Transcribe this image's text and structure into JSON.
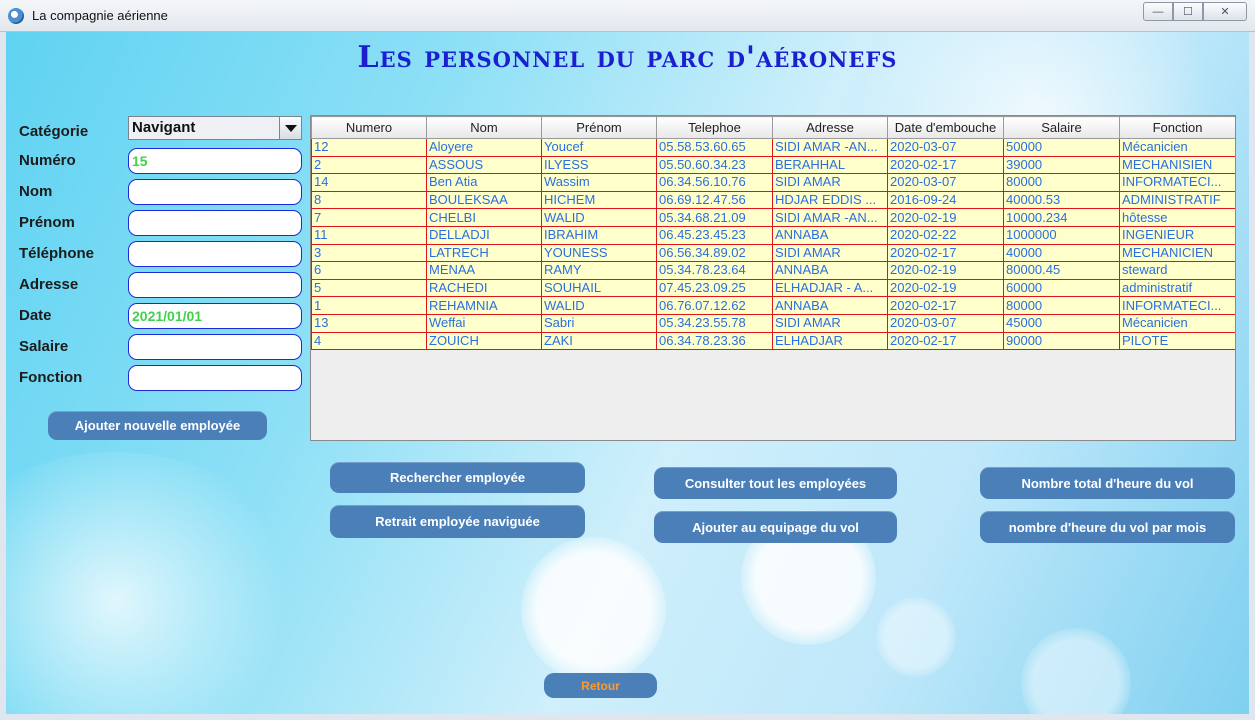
{
  "window": {
    "title": "La compagnie aérienne",
    "minimize_glyph": "—",
    "maximize_glyph": "☐",
    "close_glyph": "✕"
  },
  "page_title": "Les personnel du parc d'aéronefs",
  "form": {
    "labels": {
      "categorie": "Catégorie",
      "numero": "Numéro",
      "nom": "Nom",
      "prenom": "Prénom",
      "telephone": "Téléphone",
      "adresse": "Adresse",
      "date": "Date",
      "salaire": "Salaire",
      "fonction": "Fonction"
    },
    "values": {
      "categorie": "Navigant",
      "numero": "15",
      "nom": "",
      "prenom": "",
      "telephone": "",
      "adresse": "",
      "date": "2021/01/01",
      "salaire": "",
      "fonction": ""
    }
  },
  "buttons": {
    "ajouter": "Ajouter nouvelle employée",
    "rechercher": "Rechercher employée",
    "retrait": "Retrait employée naviguée",
    "consulter": "Consulter tout les employées",
    "equipage": "Ajouter au equipage du vol",
    "total_heures": "Nombre total d'heure du vol",
    "heures_mois": "nombre d'heure du vol par mois",
    "retour": "Retour"
  },
  "table": {
    "columns": [
      "Numero",
      "Nom",
      "Prénom",
      "Telephoe",
      "Adresse",
      "Date d'embouche",
      "Salaire",
      "Fonction"
    ],
    "rows": [
      [
        "12",
        "Aloyere",
        "Youcef",
        "05.58.53.60.65",
        "SIDI AMAR -AN...",
        "2020-03-07",
        "50000",
        "Mécanicien"
      ],
      [
        "2",
        "ASSOUS",
        "ILYESS",
        "05.50.60.34.23",
        "BERAHHAL",
        "2020-02-17",
        "39000",
        "MECHANISIEN"
      ],
      [
        "14",
        "Ben Atia",
        "Wassim",
        "06.34.56.10.76",
        "SIDI AMAR",
        "2020-03-07",
        "80000",
        "INFORMATECI..."
      ],
      [
        "8",
        "BOULEKSAA",
        "HICHEM",
        "06.69.12.47.56",
        "HDJAR EDDIS ...",
        "2016-09-24",
        "40000.53",
        "ADMINISTRATIF"
      ],
      [
        "7",
        "CHELBI",
        "WALID",
        "05.34.68.21.09",
        "SIDI AMAR -AN...",
        "2020-02-19",
        "10000.234",
        "hôtesse"
      ],
      [
        "11",
        "DELLADJI",
        "IBRAHIM",
        "06.45.23.45.23",
        "ANNABA",
        "2020-02-22",
        "1000000",
        "INGENIEUR"
      ],
      [
        "3",
        "LATRECH",
        "YOUNESS",
        "06.56.34.89.02",
        "SIDI AMAR",
        "2020-02-17",
        "40000",
        "MECHANICIEN"
      ],
      [
        "6",
        "MENAA",
        "RAMY",
        "05.34.78.23.64",
        "ANNABA",
        "2020-02-19",
        "80000.45",
        "steward"
      ],
      [
        "5",
        "RACHEDI",
        "SOUHAIL",
        "07.45.23.09.25",
        "ELHADJAR - A...",
        "2020-02-19",
        "60000",
        "administratif"
      ],
      [
        "1",
        "REHAMNIA",
        "WALID",
        "06.76.07.12.62",
        "ANNABA",
        "2020-02-17",
        "80000",
        "INFORMATECI..."
      ],
      [
        "13",
        "Weffai",
        "Sabri",
        "05.34.23.55.78",
        "SIDI AMAR",
        "2020-03-07",
        "45000",
        "Mécanicien"
      ],
      [
        "4",
        "ZOUICH",
        "ZAKI",
        "06.34.78.23.36",
        "ELHADJAR",
        "2020-02-17",
        "90000",
        "PILOTE"
      ]
    ]
  },
  "colors": {
    "title": "#1a1fd0",
    "button": "#4a7fb8",
    "cell_text": "#2a6fe0",
    "cell_bg": "#ffffcc",
    "cell_border": "#e0141a",
    "field_text": "#3fd24a",
    "retour_text": "#ff9a2e"
  }
}
